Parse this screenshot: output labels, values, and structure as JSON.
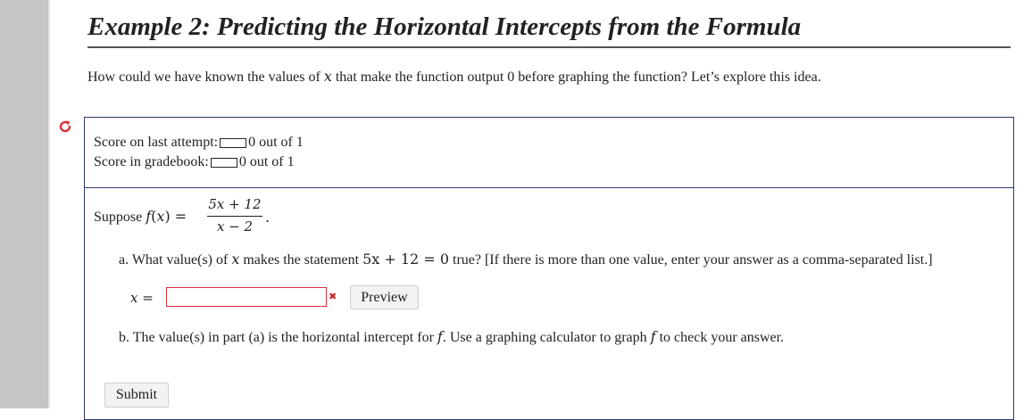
{
  "title": "Example 2: Predicting the Horizontal Intercepts from the Formula",
  "intro": {
    "before": "How could we have known the values of ",
    "var": "x",
    "after": " that make the function output 0 before graphing the function? Let’s explore this idea."
  },
  "icons": {
    "retry": "retry-icon",
    "wrong": "wrong-answer-icon",
    "wrong_glyph": "✖",
    "retry_color": "#d9303a"
  },
  "score": {
    "last_label": "Score on last attempt:",
    "last_value": "0 out of 1",
    "gradebook_label": "Score in gradebook:",
    "gradebook_value": "0 out of 1"
  },
  "question": {
    "suppose": "Suppose ",
    "fname": "f",
    "fopen": "(",
    "fvar": "x",
    "fclose": ") =",
    "numerator": "5x + 12",
    "denominator": "x − 2",
    "period": ".",
    "part_a": {
      "before": "a. What value(s) of ",
      "var": "x",
      "middle": " makes the statement ",
      "equation": "5x + 12 = 0",
      "after": " true? [If there is more than one value, enter your answer as a comma-separated list.]"
    },
    "answer_label": "x =",
    "answer_value": "",
    "preview_label": "Preview",
    "part_b": {
      "before": "b. The value(s) in part (a) is the horizontal intercept for ",
      "f1": "f",
      "middle": ". Use a graphing calculator to graph ",
      "f2": "f",
      "after": " to check your answer."
    }
  },
  "submit_label": "Submit",
  "colors": {
    "box_border": "#2d3a6b",
    "input_error_border": "#d9303a",
    "wrong_mark": "#d21f1f"
  }
}
